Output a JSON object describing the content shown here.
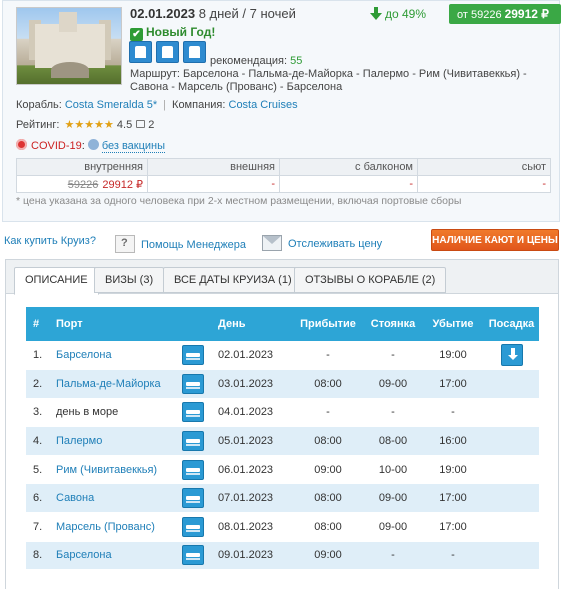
{
  "cruise": {
    "date": "02.01.2023",
    "duration": "8 дней / 7 ночей",
    "badge": "Новый Год!",
    "discount": "до 49%",
    "price_from_label": "от 59226",
    "price_new": "29912 ₽",
    "recommendation_label": "рекомендация:",
    "recommendation_value": "55",
    "route_label": "Маршрут:",
    "route_text": "Барселона - Пальма-де-Майорка - Палермо - Рим (Чивитавеккья) - Савона - Марсель (Прованс) - Барселона",
    "ship_label": "Корабль:",
    "ship_name": "Costa Smeralda 5*",
    "company_label": "Компания:",
    "company_name": "Costa Cruises",
    "rating_label": "Рейтинг:",
    "rating_stars": "★★★★★",
    "rating_value": "4.5",
    "comments_count": "2",
    "covid_label": "COVID-19",
    "covid_sep": ":",
    "vaccine_text": "без вакцины",
    "cabins": {
      "headers": [
        "внутренняя",
        "внешняя",
        "с балконом",
        "сьют"
      ],
      "inner_old": "59226",
      "inner_new": "29912 ₽",
      "outer": "-",
      "balcony": "-",
      "suite": "-"
    },
    "note": "* цена указана за одного человека при 2-х местном размещении, включая портовые сборы"
  },
  "links": {
    "how_to_buy": "Как купить Круиз?",
    "manager_help": "Помощь Менеджера",
    "track_price": "Отслеживать цену",
    "cabins_button": "НАЛИЧИЕ КАЮТ И ЦЕНЫ"
  },
  "tabs": [
    "ОПИСАНИЕ",
    "ВИЗЫ (3)",
    "ВСЕ ДАТЫ КРУИЗА (1)",
    "ОТЗЫВЫ О КОРАБЛЕ (2)"
  ],
  "itinerary": {
    "headers": {
      "num": "#",
      "port": "Порт",
      "day": "День",
      "arrival": "Прибытие",
      "stay": "Стоянка",
      "departure": "Убытие",
      "boarding": "Посадка"
    },
    "rows": [
      {
        "n": "1.",
        "port": "Барселона",
        "date": "02.01.2023",
        "arr": "-",
        "stay": "-",
        "dep": "19:00"
      },
      {
        "n": "2.",
        "port": "Пальма-де-Майорка",
        "date": "03.01.2023",
        "arr": "08:00",
        "stay": "09-00",
        "dep": "17:00"
      },
      {
        "n": "3.",
        "port": "день в море",
        "date": "04.01.2023",
        "arr": "-",
        "stay": "-",
        "dep": "-"
      },
      {
        "n": "4.",
        "port": "Палермо",
        "date": "05.01.2023",
        "arr": "08:00",
        "stay": "08-00",
        "dep": "16:00"
      },
      {
        "n": "5.",
        "port": "Рим (Чивитавеккья)",
        "date": "06.01.2023",
        "arr": "09:00",
        "stay": "10-00",
        "dep": "19:00"
      },
      {
        "n": "6.",
        "port": "Савона",
        "date": "07.01.2023",
        "arr": "08:00",
        "stay": "09-00",
        "dep": "17:00"
      },
      {
        "n": "7.",
        "port": "Марсель (Прованс)",
        "date": "08.01.2023",
        "arr": "08:00",
        "stay": "09-00",
        "dep": "17:00"
      },
      {
        "n": "8.",
        "port": "Барселона",
        "date": "09.01.2023",
        "arr": "09:00",
        "stay": "-",
        "dep": "-"
      }
    ]
  }
}
